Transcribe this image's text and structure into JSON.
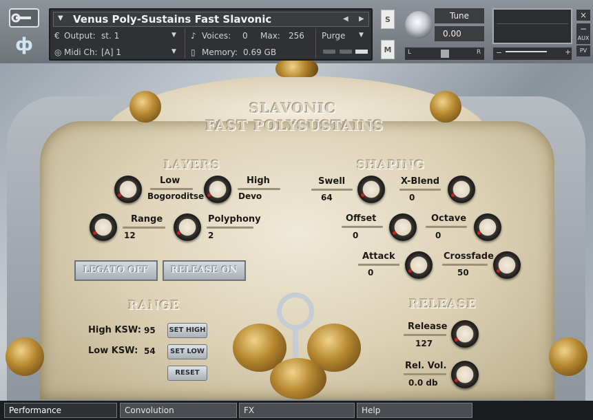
{
  "header": {
    "instrument_title": "Venus Poly-Sustains Fast Slavonic",
    "output_label": "Output:",
    "output_value": "st. 1",
    "midi_label": "Midi Ch:",
    "midi_value": "[A] 1",
    "voices_label": "Voices:",
    "voices_value": "0",
    "max_label": "Max:",
    "max_value": "256",
    "purge_label": "Purge",
    "memory_label": "Memory:",
    "memory_value": "0.69 GB",
    "solo_label": "S",
    "mute_label": "M",
    "tune_label": "Tune",
    "tune_value": "0.00",
    "pan_left": "L",
    "pan_right": "R",
    "aux_label": "AUX",
    "pv_label": "PV",
    "close_glyph": "×",
    "minus_glyph": "−",
    "plus_glyph": "+",
    "prev_glyph": "◀",
    "next_glyph": "▶",
    "menu_glyph": "▼",
    "logo_glyph": "ф"
  },
  "panel": {
    "title_line1": "SLAVONIC",
    "title_line2": "FAST POLYSUSTAINS",
    "layers": {
      "heading": "LAYERS",
      "low_label": "Low",
      "low_value": "Bogoroditse",
      "high_label": "High",
      "high_value": "Devo",
      "range_label": "Range",
      "range_value": "12",
      "polyphony_label": "Polyphony",
      "polyphony_value": "2"
    },
    "shaping": {
      "heading": "SHAPING",
      "swell_label": "Swell",
      "swell_value": "64",
      "xblend_label": "X-Blend",
      "xblend_value": "0",
      "offset_label": "Offset",
      "offset_value": "0",
      "octave_label": "Octave",
      "octave_value": "0",
      "attack_label": "Attack",
      "attack_value": "0",
      "crossfade_label": "Crossfade",
      "crossfade_value": "50"
    },
    "buttons": {
      "legato": "LEGATO OFF",
      "release": "RELEASE ON"
    },
    "range": {
      "heading": "RANGE",
      "high_ksw_label": "High KSW:",
      "high_ksw_value": "95",
      "low_ksw_label": "Low KSW:",
      "low_ksw_value": "54",
      "set_high": "SET HIGH",
      "set_low": "SET LOW",
      "reset": "RESET"
    },
    "release_section": {
      "heading": "RELEASE",
      "release_label": "Release",
      "release_value": "127",
      "relvol_label": "Rel. Vol.",
      "relvol_value": "0.0 db"
    }
  },
  "tabs": [
    "Performance",
    "Convolution",
    "FX",
    "Help"
  ],
  "colors": {
    "knob_indicator": "#d01f1f",
    "marble": "#e5dcc4",
    "gold": "#b5862f"
  }
}
